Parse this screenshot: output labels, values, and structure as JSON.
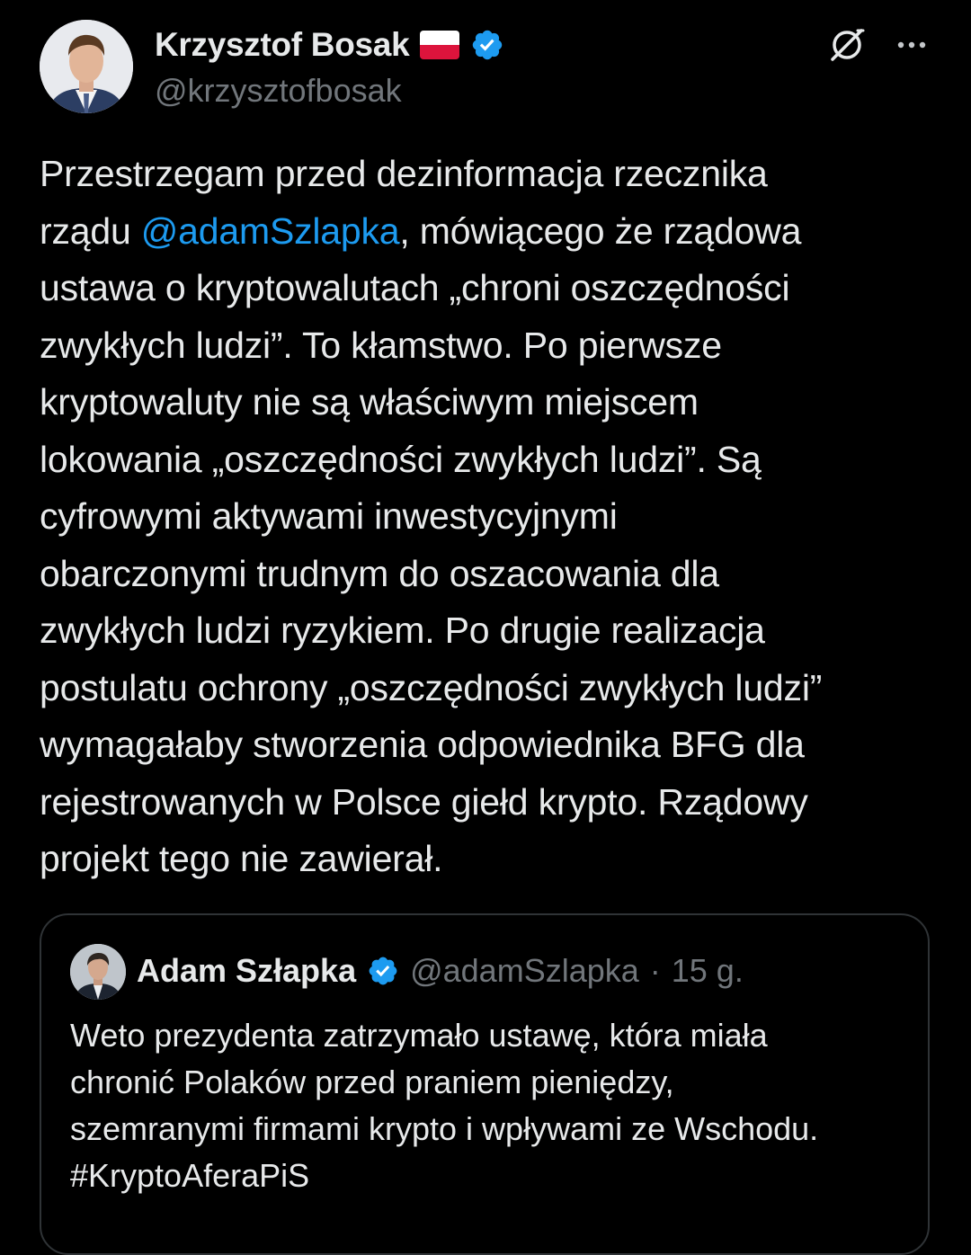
{
  "post": {
    "author": {
      "display_name": "Krzysztof Bosak",
      "handle": "@krzysztofbosak",
      "flag": "Poland",
      "verified": true
    },
    "text_lines": [
      "Przestrzegam przed dezinformacja rzecznika",
      "rządu ",
      "ustawa o kryptowalutach „chroni oszczędności",
      "zwykłych ludzi”. To kłamstwo. Po pierwsze",
      "kryptowaluty nie są właściwym miejscem",
      "lokowania „oszczędności zwykłych ludzi”. Są",
      "cyfrowymi aktywami inwestycyjnymi",
      "obarczonymi trudnym do oszacowania dla",
      "zwykłych ludzi ryzykiem. Po drugie realizacja",
      "postulatu ochrony „oszczędności zwykłych ludzi”",
      "wymagałaby stworzenia odpowiednika BFG dla",
      "rejestrowanych w Polsce giełd krypto. Rządowy",
      "projekt tego nie zawierał."
    ],
    "mention": "@adamSzlapka",
    "line2_after_mention": ", mówiącego że rządowa"
  },
  "quote": {
    "author": {
      "display_name": "Adam Szłapka",
      "handle": "@adamSzlapka",
      "verified": true
    },
    "separator": "·",
    "time": "15 g.",
    "text_lines": [
      "Weto prezydenta zatrzymało ustawę, która miała",
      "chronić Polaków przed praniem pieniędzy,",
      "szemranymi firmami krypto i wpływami ze Wschodu.",
      "#KryptoAferaPiS"
    ]
  },
  "icons": {
    "grok": "grok-icon",
    "more": "more-horizontal-icon",
    "verified": "verified-badge-icon"
  },
  "colors": {
    "background": "#000000",
    "text": "#e7e9ea",
    "secondary": "#71767b",
    "accent": "#1d9bf0",
    "border": "#2f3336"
  }
}
